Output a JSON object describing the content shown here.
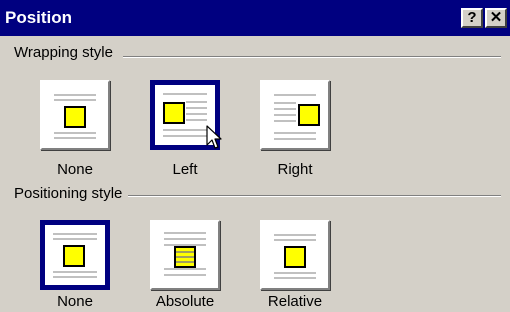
{
  "dialog": {
    "title": "Position"
  },
  "title_buttons": {
    "help": "?",
    "close": "✕"
  },
  "wrapping": {
    "label": "Wrapping style",
    "options": [
      {
        "label": "None",
        "selected": false
      },
      {
        "label": "Left",
        "selected": true
      },
      {
        "label": "Right",
        "selected": false
      }
    ]
  },
  "positioning": {
    "label": "Positioning style",
    "options": [
      {
        "label": "None",
        "selected": true
      },
      {
        "label": "Absolute",
        "selected": false
      },
      {
        "label": "Relative",
        "selected": false
      }
    ]
  },
  "colors": {
    "title_bar": "#000080",
    "selection": "#000080",
    "square": "#ffff00",
    "dialog_bg": "#d4d0c8"
  },
  "icons": {
    "cursor": "arrow-pointer-icon"
  }
}
